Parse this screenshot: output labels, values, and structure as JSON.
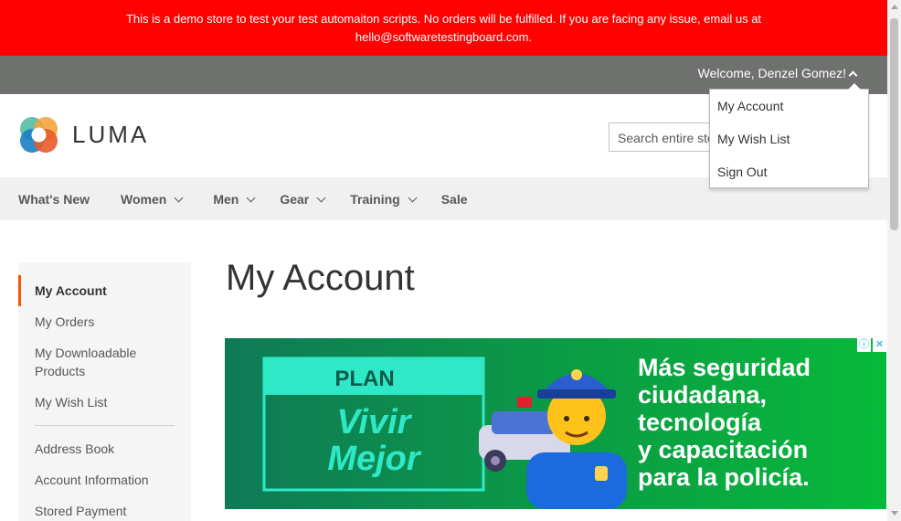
{
  "banner": {
    "line1": "This is a demo store to test your test automaiton scripts. No orders will be fulfilled. If you are facing any issue, email us at",
    "line2": "hello@softwaretestingboard.com."
  },
  "header": {
    "welcome": "Welcome, Denzel Gomez!",
    "logo_text": "LUMA",
    "search_placeholder": "Search entire store here..."
  },
  "account_dropdown": {
    "items": [
      "My Account",
      "My Wish List",
      "Sign Out"
    ]
  },
  "nav": {
    "items": [
      {
        "label": "What's New",
        "has_dropdown": false
      },
      {
        "label": "Women",
        "has_dropdown": true
      },
      {
        "label": "Men",
        "has_dropdown": true
      },
      {
        "label": "Gear",
        "has_dropdown": true
      },
      {
        "label": "Training",
        "has_dropdown": true
      },
      {
        "label": "Sale",
        "has_dropdown": false
      }
    ]
  },
  "sidebar": {
    "items": [
      "My Account",
      "My Orders",
      "My Downloadable Products",
      "My Wish List",
      "Address Book",
      "Account Information",
      "Stored Payment Methods"
    ]
  },
  "main": {
    "title": "My Account"
  },
  "ad": {
    "plan": "PLAN",
    "vivir": "Vivir",
    "mejor": "Mejor",
    "line1": "Más seguridad",
    "line2": "ciudadana,",
    "line3": "tecnología",
    "line4": "y capacitación",
    "line5": "para la policía.",
    "info_icon": "ⓘ",
    "close_icon": "✕"
  },
  "colors": {
    "banner_bg": "#ff0101",
    "panel_bg": "#6e716e",
    "nav_bg": "#f0f0f0",
    "accent": "#ff5501",
    "ad_teal": "#2fe8c8"
  }
}
